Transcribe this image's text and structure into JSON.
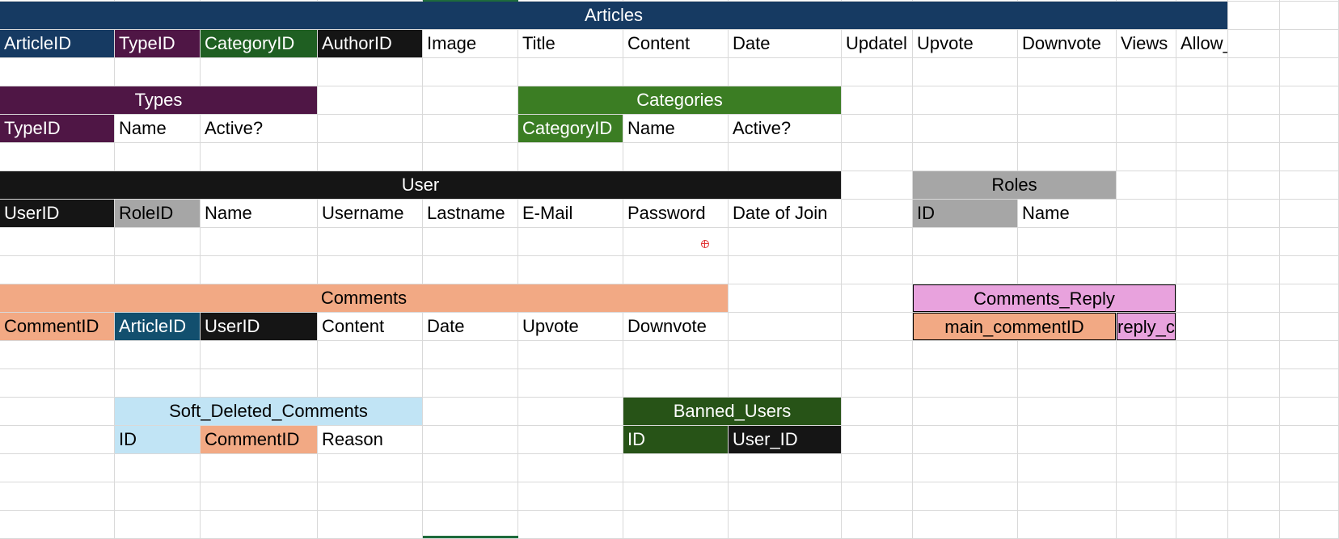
{
  "colors": {
    "navy": "#163a62",
    "purple": "#4f1645",
    "dark_green": "#1f5f22",
    "darker_green": "#275317",
    "black": "#151515",
    "gray": "#a6a6a6",
    "olive_green": "#3b7d23",
    "salmon": "#f2a984",
    "teal_blue": "#124f6e",
    "pink": "#e8a2dd",
    "light_blue": "#c1e4f5"
  },
  "tables": {
    "articles": {
      "title": "Articles",
      "fields": [
        "ArticleID",
        "TypeID",
        "CategoryID",
        "AuthorID",
        "Image",
        "Title",
        "Content",
        "Date",
        "Updatel",
        "Upvote",
        "Downvote",
        "Views",
        "Allow_Comments"
      ]
    },
    "types": {
      "title": "Types",
      "fields": [
        "TypeID",
        "Name",
        "Active?"
      ]
    },
    "categories": {
      "title": "Categories",
      "fields": [
        "CategoryID",
        "Name",
        "Active?"
      ]
    },
    "user": {
      "title": "User",
      "fields": [
        "UserID",
        "RoleID",
        "Name",
        "Username",
        "Lastname",
        "E-Mail",
        "Password",
        "Date of Join"
      ]
    },
    "roles": {
      "title": "Roles",
      "fields": [
        "ID",
        "Name"
      ]
    },
    "comments": {
      "title": "Comments",
      "fields": [
        "CommentID",
        "ArticleID",
        "UserID",
        "Content",
        "Date",
        "Upvote",
        "Downvote"
      ]
    },
    "comments_reply": {
      "title": "Comments_Reply",
      "fields": [
        "main_commentID",
        "reply_commentID"
      ]
    },
    "soft_deleted_comments": {
      "title": "Soft_Deleted_Comments",
      "fields": [
        "ID",
        "CommentID",
        "Reason"
      ]
    },
    "banned_users": {
      "title": "Banned_Users",
      "fields": [
        "ID",
        "User_ID"
      ]
    }
  }
}
